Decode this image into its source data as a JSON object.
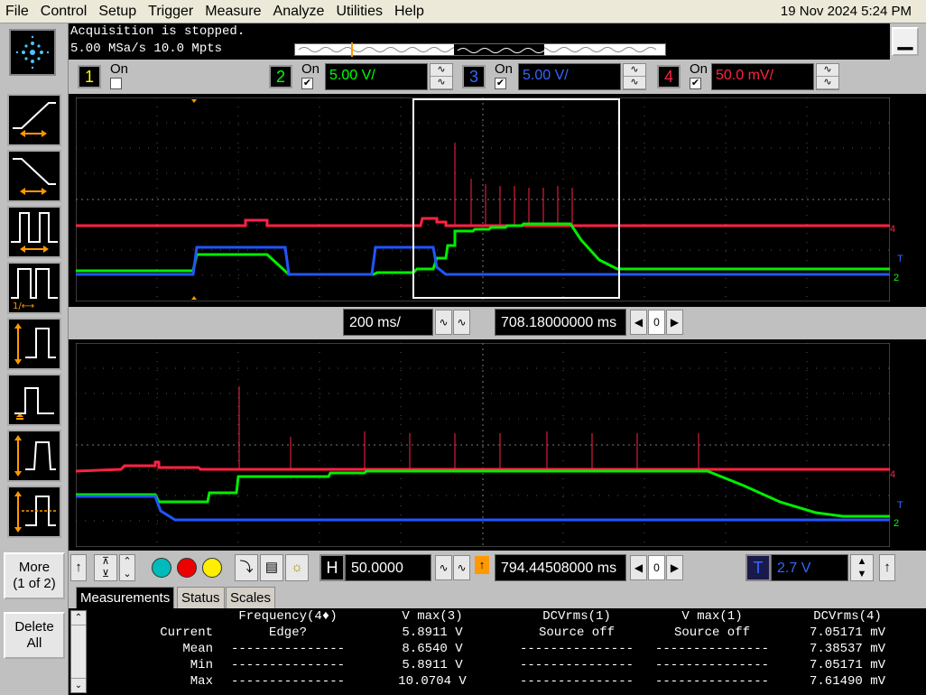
{
  "menu": {
    "items": [
      "File",
      "Control",
      "Setup",
      "Trigger",
      "Measure",
      "Analyze",
      "Utilities",
      "Help"
    ],
    "datetime": "19 Nov 2024   5:24 PM"
  },
  "acquisition": {
    "status": "Acquisition is stopped.",
    "rate": "5.00 MSa/s   10.0 Mpts"
  },
  "channels": [
    {
      "num": "1",
      "on_label": "On",
      "checked": "",
      "scale": "",
      "color": "#ffff00"
    },
    {
      "num": "2",
      "on_label": "On",
      "checked": "✔",
      "scale": "5.00 V/",
      "color": "#00ff00"
    },
    {
      "num": "3",
      "on_label": "On",
      "checked": "✔",
      "scale": "5.00 V/",
      "color": "#3366ff"
    },
    {
      "num": "4",
      "on_label": "On",
      "checked": "✔",
      "scale": "50.0 mV/",
      "color": "#ff2244"
    }
  ],
  "timebase": {
    "main_scale": "200 ms/",
    "main_position": "708.18000000 ms",
    "zoom_scale": "50.0000 ms/",
    "zoom_position": "794.44508000 ms",
    "zero": "0"
  },
  "trigger": {
    "level": "2.7 V",
    "label": "T"
  },
  "side": {
    "more_label": "More",
    "more_page": "(1 of 2)",
    "delete_label": "Delete",
    "delete_all": "All"
  },
  "controls": {
    "h_label": "H"
  },
  "tabs": [
    "Measurements",
    "Status",
    "Scales"
  ],
  "measurements": {
    "headers": [
      "",
      "Frequency(4♦)",
      "V max(3)",
      "DCVrms(1)",
      "V max(1)",
      "DCVrms(4)"
    ],
    "rows": [
      [
        "Current",
        "Edge?",
        "5.8911 V",
        "Source off",
        "Source off",
        "7.05171 mV"
      ],
      [
        "Mean",
        "---------------",
        "8.6540 V",
        "---------------",
        "---------------",
        "7.38537 mV"
      ],
      [
        "Min",
        "---------------",
        "5.8911 V",
        "---------------",
        "---------------",
        "7.05171 mV"
      ],
      [
        "Max",
        "---------------",
        "10.0704 V",
        "---------------",
        "---------------",
        "7.61490 mV"
      ]
    ]
  },
  "markers": {
    "ch4": "4",
    "ch2": "2",
    "trig": "T"
  }
}
